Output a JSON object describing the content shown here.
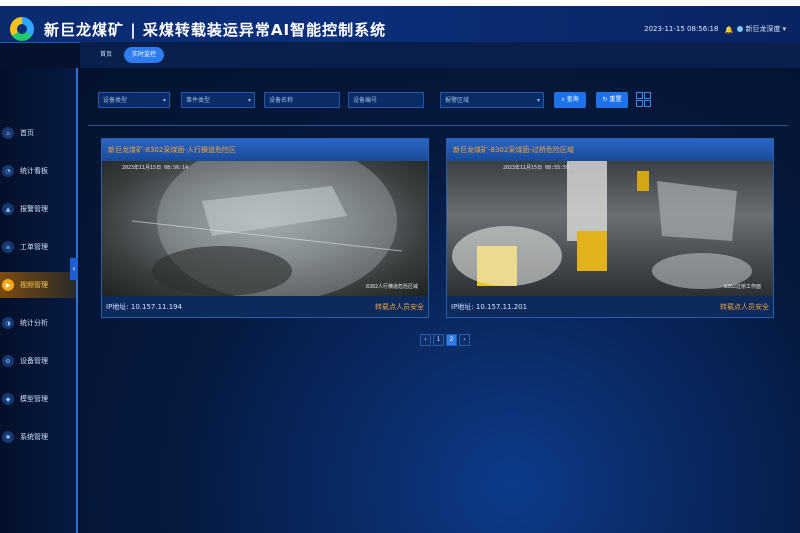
{
  "header": {
    "title": "新巨龙煤矿 | 采煤转载装运异常AI智能控制系统",
    "datetime": "2023-11-15 08:56:18",
    "user": "新巨龙深度"
  },
  "tabs": [
    {
      "label": "首页"
    },
    {
      "label": "实时监控"
    }
  ],
  "sidebar": {
    "items": [
      {
        "label": "首页"
      },
      {
        "label": "统计看板"
      },
      {
        "label": "报警管理"
      },
      {
        "label": "工单管理"
      },
      {
        "label": "视频管理"
      },
      {
        "label": "统计分析"
      },
      {
        "label": "设备管理"
      },
      {
        "label": "模型管理"
      },
      {
        "label": "系统管理"
      }
    ]
  },
  "filters": {
    "device_type": "设备类型",
    "event_type": "事件类型",
    "device_name": "设备名称",
    "device_code": "设备编号",
    "alarm_area": "报警区域",
    "search_label": "查询",
    "reset_label": "重置"
  },
  "cameras": [
    {
      "title": "新巨龙煤矿-8302采煤面-人行横道危险区",
      "timestamp": "2023年11月15日 08:56:14",
      "overlay": "8302人行横道危险区域",
      "ip": "IP地址: 10.157.11.194",
      "status": "转载点人员安全"
    },
    {
      "title": "新巨龙煤矿-8302采煤面-过桥危险区域",
      "timestamp": "2023年11月15日 08:55:59",
      "overlay": "8302过桥工作面",
      "ip": "IP地址: 10.157.11.201",
      "status": "转载点人员安全"
    }
  ],
  "pagination": {
    "prev": "‹",
    "pages": [
      "1",
      "2"
    ],
    "next": "›",
    "current": "2"
  },
  "colors": {
    "accent": "#2d7cf0",
    "warning": "#f3a13a"
  }
}
